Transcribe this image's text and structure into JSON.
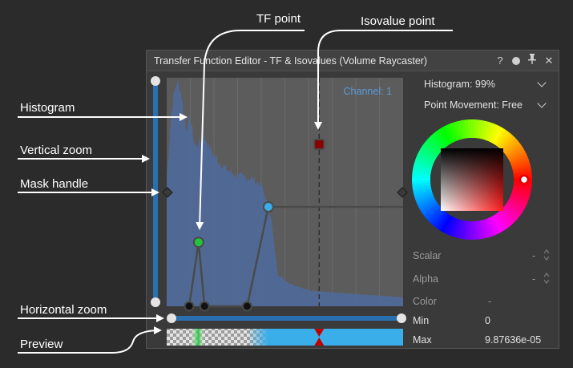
{
  "annotations": {
    "tf_point": "TF point",
    "isovalue_point": "Isovalue point",
    "histogram": "Histogram",
    "vertical_zoom": "Vertical zoom",
    "mask_handle": "Mask handle",
    "horizontal_zoom": "Horizontal zoom",
    "preview": "Preview"
  },
  "window": {
    "title": "Transfer Function Editor - TF & Isovalues (Volume Raycaster)",
    "icons": [
      "help-icon",
      "record-dot-icon",
      "pin-icon",
      "close-icon"
    ],
    "help_glyph": "?",
    "close_glyph": "✕"
  },
  "canvas": {
    "channel_label": "Channel: 1",
    "accent_color": "#2a6fb0",
    "tf_line_color": "#4a4a4a",
    "points": [
      {
        "name": "tf-point-1",
        "x": 0.095,
        "alpha": 0.0,
        "color": "#111111"
      },
      {
        "name": "tf-point-green",
        "x": 0.135,
        "alpha": 0.28,
        "color": "#21c43a"
      },
      {
        "name": "tf-point-3",
        "x": 0.16,
        "alpha": 0.0,
        "color": "#111111"
      },
      {
        "name": "tf-point-4",
        "x": 0.34,
        "alpha": 0.0,
        "color": "#111111"
      },
      {
        "name": "tf-point-blue",
        "x": 0.43,
        "alpha": 0.435,
        "color": "#3aaee8"
      }
    ],
    "isovalue": {
      "x": 0.645,
      "color": "#8a0000"
    }
  },
  "side_panel": {
    "histogram_mode": "Histogram: 99%",
    "point_movement": "Point Movement: Free",
    "fields": [
      {
        "label": "Scalar",
        "value": "-"
      },
      {
        "label": "Alpha",
        "value": "-"
      },
      {
        "label": "Color",
        "value": "-"
      },
      {
        "label": "Min",
        "value": "0"
      },
      {
        "label": "Max",
        "value": "9.87636e-05"
      }
    ]
  }
}
